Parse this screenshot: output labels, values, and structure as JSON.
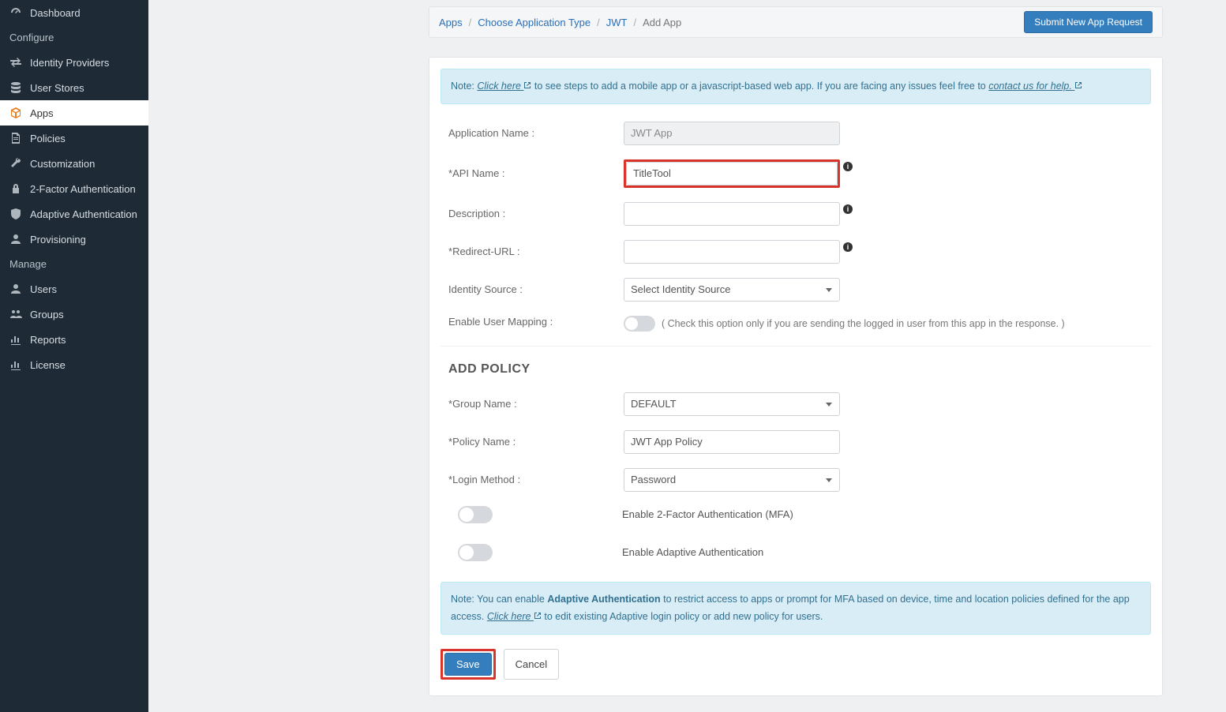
{
  "sidebar": {
    "items": [
      {
        "label": "Dashboard"
      }
    ],
    "configure_label": "Configure",
    "configure_items": [
      {
        "label": "Identity Providers"
      },
      {
        "label": "User Stores"
      },
      {
        "label": "Apps"
      },
      {
        "label": "Policies"
      },
      {
        "label": "Customization"
      },
      {
        "label": "2-Factor Authentication"
      },
      {
        "label": "Adaptive Authentication"
      },
      {
        "label": "Provisioning"
      }
    ],
    "manage_label": "Manage",
    "manage_items": [
      {
        "label": "Users"
      },
      {
        "label": "Groups"
      },
      {
        "label": "Reports"
      },
      {
        "label": "License"
      }
    ]
  },
  "breadcrumb": {
    "apps": "Apps",
    "choose": "Choose Application Type",
    "jwt": "JWT",
    "add": "Add App"
  },
  "header": {
    "submit_btn": "Submit New App Request"
  },
  "note1": {
    "prefix": "Note: ",
    "click_here": "Click here",
    "mid": " to see steps to add a mobile app or a javascript-based web app. If you are facing any issues feel free to ",
    "contact": "contact us for help."
  },
  "form": {
    "app_name_label": "Application Name :",
    "app_name_value": "JWT App",
    "api_name_label": "API Name :",
    "api_name_value": "TitleTool",
    "description_label": "Description :",
    "description_value": "",
    "redirect_label": "Redirect-URL :",
    "redirect_value": "",
    "identity_label": "Identity Source :",
    "identity_value": "Select Identity Source",
    "mapping_label": "Enable User Mapping :",
    "mapping_help": "( Check this option only if you are sending the logged in user from this app in the response. )"
  },
  "policy": {
    "heading": "ADD POLICY",
    "group_label": "Group Name :",
    "group_value": "DEFAULT",
    "policy_label": "Policy Name :",
    "policy_value": "JWT App Policy",
    "login_label": "Login Method :",
    "login_value": "Password",
    "mfa_label": "Enable 2-Factor Authentication (MFA)",
    "adaptive_label": "Enable Adaptive Authentication"
  },
  "note2": {
    "prefix": "Note: You can enable ",
    "bold": "Adaptive Authentication",
    "mid": " to restrict access to apps or prompt for MFA based on device, time and location policies defined for the app access. ",
    "click": "Click here",
    "suffix": " to edit existing Adaptive login policy or add new policy for users."
  },
  "actions": {
    "save": "Save",
    "cancel": "Cancel"
  }
}
